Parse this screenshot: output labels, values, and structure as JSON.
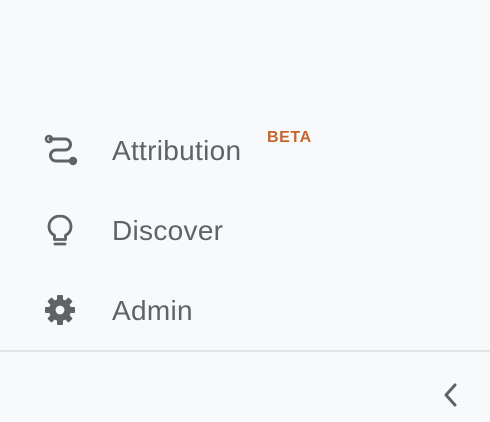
{
  "nav": {
    "items": [
      {
        "label": "Attribution",
        "badge": "BETA",
        "icon": "attribution-route-icon"
      },
      {
        "label": "Discover",
        "icon": "lightbulb-icon"
      },
      {
        "label": "Admin",
        "icon": "gear-icon"
      }
    ]
  },
  "footer": {
    "collapse_icon": "chevron-left-icon"
  },
  "colors": {
    "background": "#f8f9fa",
    "text": "#5f6368",
    "badge": "#c5652b",
    "divider": "#e1e3e6"
  }
}
